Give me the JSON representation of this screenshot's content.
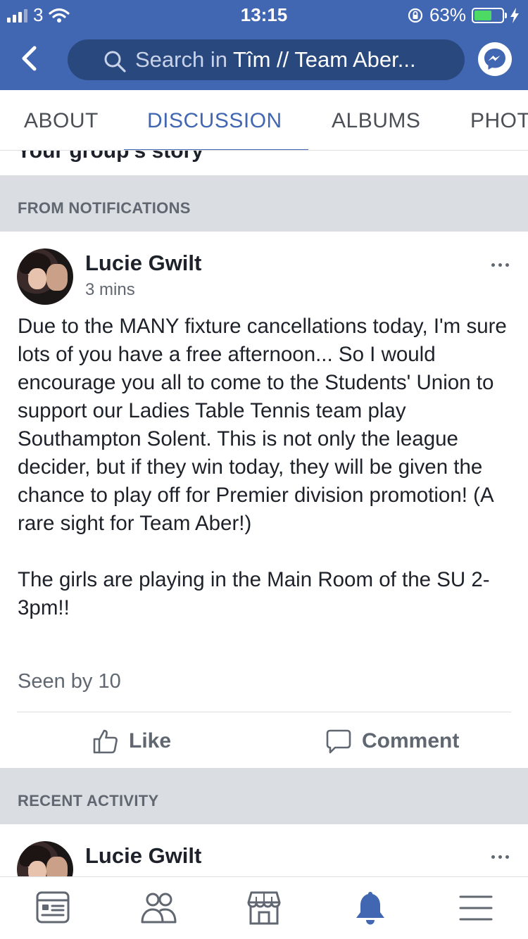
{
  "status_bar": {
    "carrier": "3",
    "time": "13:15",
    "battery": "63%"
  },
  "header": {
    "search_prefix": "Search in ",
    "search_group": "Tîm // Team Aber..."
  },
  "tabs": [
    {
      "label": "ABOUT"
    },
    {
      "label": "DISCUSSION"
    },
    {
      "label": "ALBUMS"
    },
    {
      "label": "PHOTOS"
    }
  ],
  "peek_text": "Your group's story",
  "sections": {
    "notifications": "FROM NOTIFICATIONS",
    "recent": "RECENT ACTIVITY"
  },
  "post": {
    "author": "Lucie Gwilt",
    "time": "3 mins",
    "body": "Due to the MANY fixture cancellations today, I'm sure lots of you have a free afternoon... So I would encourage you all to come to the Students' Union to support our Ladies Table Tennis team play Southampton Solent. This is not only the league decider, but if they win today, they will be given the chance to play off for Premier division promotion! (A rare sight for Team Aber!)\n\nThe girls are playing in the Main Room of the SU 2-3pm!!",
    "seen_by": "Seen by 10",
    "like_label": "Like",
    "comment_label": "Comment"
  },
  "recent_post": {
    "author": "Lucie Gwilt"
  },
  "bottom_nav": [
    {
      "icon": "news-feed-icon"
    },
    {
      "icon": "friends-icon"
    },
    {
      "icon": "marketplace-icon"
    },
    {
      "icon": "notifications-bell-icon",
      "active": true
    },
    {
      "icon": "menu-icon"
    }
  ],
  "colors": {
    "brand": "#4267b2",
    "search_bg": "#29487d",
    "section_bg": "#dadde1",
    "muted_text": "#606770"
  }
}
